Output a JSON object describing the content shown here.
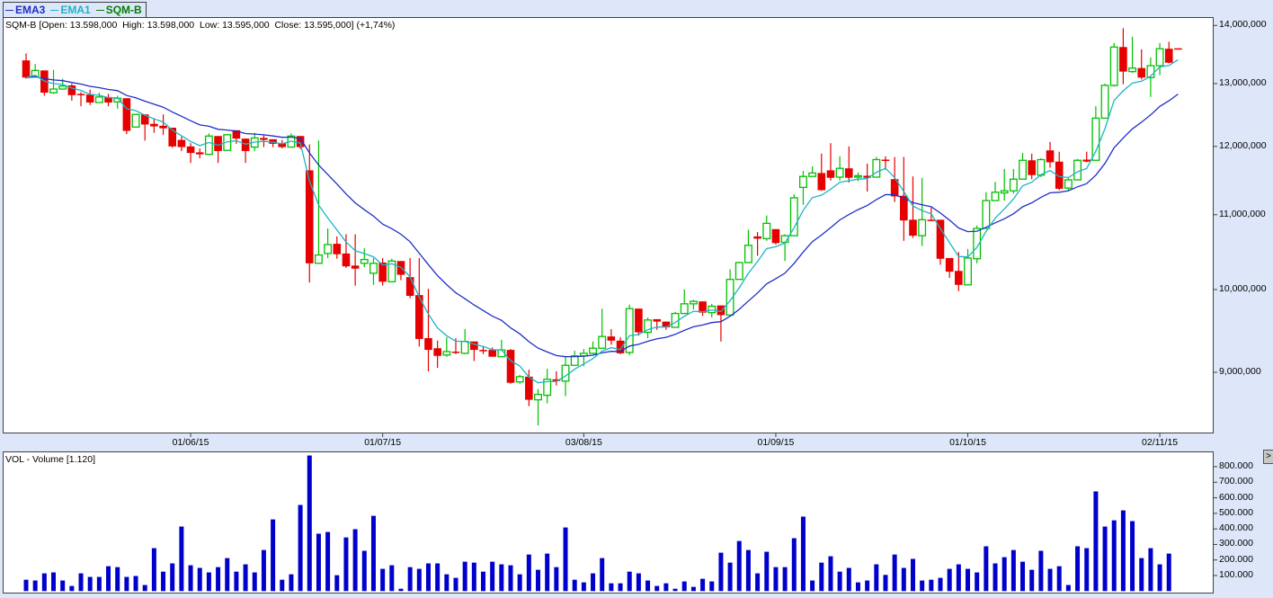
{
  "legend": [
    {
      "label": "EMA3",
      "color": "#1f2fc8"
    },
    {
      "label": "EMA1",
      "color": "#1cb4c8"
    },
    {
      "label": "SQM-B",
      "color": "#008000"
    }
  ],
  "info_line": "SQM-B [Open: 13.598,000  High: 13.598,000  Low: 13.595,000  Close: 13.595,000] (+1,74%)",
  "volume_label": "VOL - Volume [1.120]",
  "nav_button": ">",
  "colors": {
    "up": "#00c000",
    "down": "#e60000",
    "volume": "#0000cc",
    "ema3": "#1f2fc8",
    "ema1": "#1cb4c8"
  },
  "chart_data": [
    {
      "type": "candlestick",
      "title": "SQM-B",
      "y_scale": "log",
      "ylim": [
        8400000,
        14200000
      ],
      "yticks": [
        {
          "value": 14000000,
          "label": "14,000,000"
        },
        {
          "value": 13000000,
          "label": "13,000,000"
        },
        {
          "value": 12000000,
          "label": "12,000,000"
        },
        {
          "value": 11000000,
          "label": "11,000,000"
        },
        {
          "value": 10000000,
          "label": "10,000,000"
        },
        {
          "value": 9000000,
          "label": "9,000,000"
        }
      ],
      "xticks": [
        {
          "index": 18,
          "label": "01/06/15"
        },
        {
          "index": 39,
          "label": "01/07/15"
        },
        {
          "index": 61,
          "label": "03/08/15"
        },
        {
          "index": 82,
          "label": "01/09/15"
        },
        {
          "index": 103,
          "label": "01/10/15"
        },
        {
          "index": 124,
          "label": "02/11/15"
        }
      ],
      "series_overlays": [
        "EMA3",
        "EMA1"
      ],
      "ohlc": [
        [
          13390000,
          13510000,
          13080000,
          13100000
        ],
        [
          13110000,
          13330000,
          13110000,
          13220000
        ],
        [
          13220000,
          13220000,
          12800000,
          12850000
        ],
        [
          12850000,
          13230000,
          12830000,
          12910000
        ],
        [
          12910000,
          13080000,
          12910000,
          12960000
        ],
        [
          12970000,
          13000000,
          12720000,
          12810000
        ],
        [
          12830000,
          12860000,
          12630000,
          12810000
        ],
        [
          12820000,
          12900000,
          12650000,
          12690000
        ],
        [
          12690000,
          12850000,
          12690000,
          12780000
        ],
        [
          12780000,
          12830000,
          12630000,
          12690000
        ],
        [
          12700000,
          12800000,
          12590000,
          12760000
        ],
        [
          12760000,
          12760000,
          12190000,
          12240000
        ],
        [
          12300000,
          12500000,
          12300000,
          12500000
        ],
        [
          12500000,
          12500000,
          12090000,
          12340000
        ],
        [
          12350000,
          12440000,
          12210000,
          12310000
        ],
        [
          12320000,
          12500000,
          12180000,
          12280000
        ],
        [
          12290000,
          12290000,
          11980000,
          12000000
        ],
        [
          12100000,
          12150000,
          11930000,
          11990000
        ],
        [
          12000000,
          12050000,
          11750000,
          11900000
        ],
        [
          11910000,
          11970000,
          11820000,
          11880000
        ],
        [
          11880000,
          12200000,
          11880000,
          12160000
        ],
        [
          12160000,
          12160000,
          11750000,
          11930000
        ],
        [
          11940000,
          12190000,
          11940000,
          12180000
        ],
        [
          12250000,
          12250000,
          12040000,
          12120000
        ],
        [
          12120000,
          12120000,
          11750000,
          11930000
        ],
        [
          11990000,
          12210000,
          11930000,
          12130000
        ],
        [
          12130000,
          12170000,
          11990000,
          12100000
        ],
        [
          12110000,
          12110000,
          11990000,
          12040000
        ],
        [
          12050000,
          12100000,
          11970000,
          11990000
        ],
        [
          11990000,
          12200000,
          11990000,
          12160000
        ],
        [
          12160000,
          12160000,
          11960000,
          11990000
        ],
        [
          11640000,
          12030000,
          10090000,
          10340000
        ],
        [
          10340000,
          12090000,
          10340000,
          10450000
        ],
        [
          10470000,
          10810000,
          10410000,
          10590000
        ],
        [
          10600000,
          10700000,
          10400000,
          10460000
        ],
        [
          10470000,
          10730000,
          10280000,
          10300000
        ],
        [
          10310000,
          10730000,
          10050000,
          10270000
        ],
        [
          10340000,
          10540000,
          10290000,
          10390000
        ],
        [
          10210000,
          10410000,
          10060000,
          10340000
        ],
        [
          10350000,
          10410000,
          10050000,
          10100000
        ],
        [
          10100000,
          10400000,
          10100000,
          10370000
        ],
        [
          10370000,
          10370000,
          10120000,
          10190000
        ],
        [
          10160000,
          10410000,
          9890000,
          9920000
        ],
        [
          9930000,
          10410000,
          9300000,
          9390000
        ],
        [
          9400000,
          10010000,
          9010000,
          9260000
        ],
        [
          9280000,
          9370000,
          9050000,
          9190000
        ],
        [
          9200000,
          9410000,
          9180000,
          9240000
        ],
        [
          9240000,
          9400000,
          9210000,
          9230000
        ],
        [
          9220000,
          9510000,
          9210000,
          9360000
        ],
        [
          9360000,
          9360000,
          9130000,
          9260000
        ],
        [
          9260000,
          9300000,
          9210000,
          9250000
        ],
        [
          9260000,
          9290000,
          9180000,
          9180000
        ],
        [
          9180000,
          9380000,
          9180000,
          9260000
        ],
        [
          9260000,
          9270000,
          8870000,
          8880000
        ],
        [
          8890000,
          8970000,
          8870000,
          8950000
        ],
        [
          8950000,
          9030000,
          8620000,
          8690000
        ],
        [
          8690000,
          8810000,
          8410000,
          8750000
        ],
        [
          8740000,
          9040000,
          8650000,
          8920000
        ],
        [
          8920000,
          9010000,
          8850000,
          8900000
        ],
        [
          8900000,
          9190000,
          8730000,
          9080000
        ],
        [
          9080000,
          9250000,
          9080000,
          9190000
        ],
        [
          9190000,
          9270000,
          9070000,
          9220000
        ],
        [
          9220000,
          9360000,
          9210000,
          9280000
        ],
        [
          9280000,
          9760000,
          9280000,
          9420000
        ],
        [
          9420000,
          9510000,
          9320000,
          9370000
        ],
        [
          9370000,
          9410000,
          9210000,
          9220000
        ],
        [
          9230000,
          9810000,
          9200000,
          9760000
        ],
        [
          9760000,
          9760000,
          9430000,
          9470000
        ],
        [
          9470000,
          9650000,
          9400000,
          9620000
        ],
        [
          9630000,
          9630000,
          9500000,
          9600000
        ],
        [
          9600000,
          9600000,
          9500000,
          9530000
        ],
        [
          9530000,
          9720000,
          9530000,
          9700000
        ],
        [
          9700000,
          10000000,
          9700000,
          9820000
        ],
        [
          9820000,
          9870000,
          9750000,
          9850000
        ],
        [
          9850000,
          9850000,
          9670000,
          9710000
        ],
        [
          9710000,
          9820000,
          9650000,
          9790000
        ],
        [
          9800000,
          9800000,
          9360000,
          9680000
        ],
        [
          9680000,
          10260000,
          9680000,
          10130000
        ],
        [
          10130000,
          10360000,
          10130000,
          10350000
        ],
        [
          10350000,
          10790000,
          10350000,
          10580000
        ],
        [
          10700000,
          10760000,
          10440000,
          10670000
        ],
        [
          10670000,
          10990000,
          10640000,
          10880000
        ],
        [
          10800000,
          10800000,
          10590000,
          10610000
        ],
        [
          10620000,
          10730000,
          10370000,
          10710000
        ],
        [
          10710000,
          11290000,
          10710000,
          11240000
        ],
        [
          11390000,
          11630000,
          11140000,
          11550000
        ],
        [
          11550000,
          11700000,
          11550000,
          11600000
        ],
        [
          11600000,
          11890000,
          11340000,
          11350000
        ],
        [
          11640000,
          12050000,
          11490000,
          11530000
        ],
        [
          11540000,
          11850000,
          11490000,
          11670000
        ],
        [
          11670000,
          12000000,
          11460000,
          11530000
        ],
        [
          11540000,
          11610000,
          11480000,
          11560000
        ],
        [
          11560000,
          11740000,
          11330000,
          11530000
        ],
        [
          11540000,
          11840000,
          11540000,
          11800000
        ],
        [
          11800000,
          11850000,
          11650000,
          11790000
        ],
        [
          11510000,
          11840000,
          11180000,
          11260000
        ],
        [
          11270000,
          11840000,
          10640000,
          10920000
        ],
        [
          10930000,
          11550000,
          10680000,
          10710000
        ],
        [
          10710000,
          11530000,
          10570000,
          10930000
        ],
        [
          10930000,
          11100000,
          10910000,
          10920000
        ],
        [
          10930000,
          10930000,
          10320000,
          10400000
        ],
        [
          10410000,
          10410000,
          10150000,
          10230000
        ],
        [
          10240000,
          10490000,
          9980000,
          10060000
        ],
        [
          10060000,
          10530000,
          10060000,
          10410000
        ],
        [
          10400000,
          10850000,
          10340000,
          10810000
        ],
        [
          10810000,
          11320000,
          10810000,
          11200000
        ],
        [
          11200000,
          11470000,
          11200000,
          11320000
        ],
        [
          11310000,
          11660000,
          11200000,
          11340000
        ],
        [
          11340000,
          11660000,
          11300000,
          11510000
        ],
        [
          11510000,
          11900000,
          11510000,
          11790000
        ],
        [
          11790000,
          11890000,
          11510000,
          11570000
        ],
        [
          11570000,
          11820000,
          11540000,
          11800000
        ],
        [
          11940000,
          12070000,
          11680000,
          11760000
        ],
        [
          11770000,
          11920000,
          11350000,
          11370000
        ],
        [
          11380000,
          11540000,
          11350000,
          11500000
        ],
        [
          11500000,
          11810000,
          11500000,
          11790000
        ],
        [
          11800000,
          11920000,
          11760000,
          11770000
        ],
        [
          11790000,
          12630000,
          11790000,
          12440000
        ],
        [
          12440000,
          13000000,
          12430000,
          12970000
        ],
        [
          12970000,
          13690000,
          12950000,
          13620000
        ],
        [
          13620000,
          13950000,
          12990000,
          13200000
        ],
        [
          13200000,
          13800000,
          13180000,
          13260000
        ],
        [
          13260000,
          13580000,
          13070000,
          13100000
        ],
        [
          13100000,
          13440000,
          12780000,
          13300000
        ],
        [
          13300000,
          13690000,
          13140000,
          13590000
        ],
        [
          13590000,
          13710000,
          13340000,
          13350000
        ],
        [
          13598000,
          13598000,
          13595000,
          13595000
        ]
      ]
    },
    {
      "type": "bar",
      "title": "VOL - Volume",
      "ylim": [
        0,
        900000
      ],
      "yticks": [
        {
          "value": 800000,
          "label": "800.000"
        },
        {
          "value": 700000,
          "label": "700.000"
        },
        {
          "value": 600000,
          "label": "600.000"
        },
        {
          "value": 500000,
          "label": "500.000"
        },
        {
          "value": 400000,
          "label": "400.000"
        },
        {
          "value": 300000,
          "label": "300.000"
        },
        {
          "value": 200000,
          "label": "200.000"
        },
        {
          "value": 100000,
          "label": "100.000"
        }
      ],
      "values": [
        73000,
        68000,
        114000,
        120000,
        68000,
        33000,
        114000,
        91000,
        91000,
        160000,
        154000,
        91000,
        97000,
        39000,
        276000,
        125000,
        178000,
        415000,
        166000,
        149000,
        120000,
        154000,
        212000,
        125000,
        172000,
        120000,
        264000,
        461000,
        73000,
        108000,
        554000,
        872000,
        369000,
        380000,
        102000,
        345000,
        398000,
        259000,
        484000,
        143000,
        166000,
        15000,
        154000,
        143000,
        178000,
        178000,
        108000,
        85000,
        189000,
        183000,
        125000,
        189000,
        172000,
        166000,
        108000,
        235000,
        137000,
        241000,
        154000,
        409000,
        73000,
        56000,
        114000,
        212000,
        50000,
        50000,
        125000,
        114000,
        68000,
        33000,
        50000,
        15000,
        62000,
        27000,
        79000,
        62000,
        247000,
        183000,
        322000,
        264000,
        114000,
        253000,
        154000,
        154000,
        340000,
        479000,
        68000,
        183000,
        224000,
        125000,
        149000,
        56000,
        68000,
        172000,
        104000,
        235000,
        149000,
        207000,
        68000,
        73000,
        85000,
        143000,
        172000,
        143000,
        120000,
        288000,
        178000,
        218000,
        264000,
        189000,
        137000,
        259000,
        143000,
        160000,
        39000,
        288000,
        276000,
        641000,
        415000,
        455000,
        519000,
        450000,
        212000,
        276000,
        172000,
        241000,
        0
      ]
    }
  ]
}
